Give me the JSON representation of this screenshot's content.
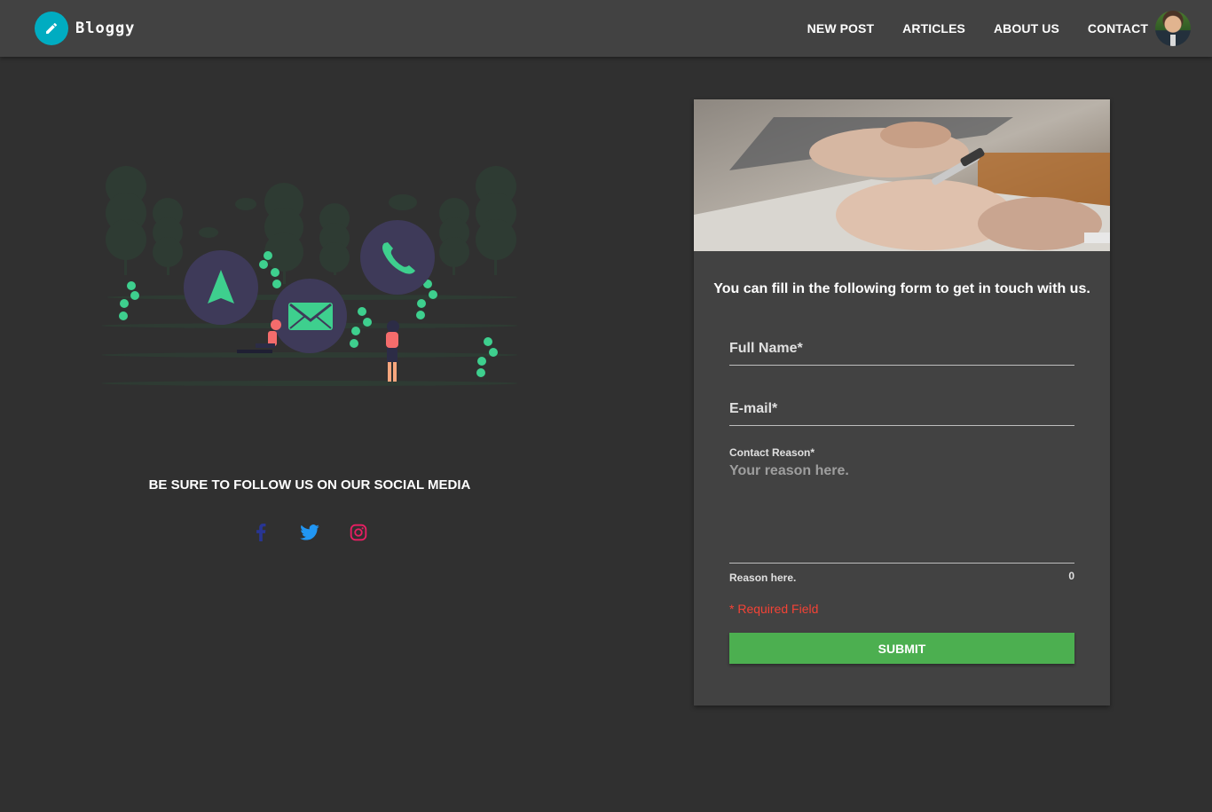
{
  "header": {
    "brand": "Bloggy",
    "nav": [
      "NEW POST",
      "ARTICLES",
      "ABOUT US",
      "CONTACT"
    ]
  },
  "social": {
    "heading": "BE SURE TO FOLLOW US ON OUR SOCIAL MEDIA",
    "links": [
      {
        "icon": "facebook-icon",
        "color": "#283593"
      },
      {
        "icon": "twitter-icon",
        "color": "#2196f3"
      },
      {
        "icon": "instagram-icon",
        "color": "#e91e63"
      }
    ]
  },
  "form": {
    "intro": "You can fill in the following form to get in touch with us.",
    "full_name_label": "Full Name*",
    "email_label": "E-mail*",
    "reason_label": "Contact Reason*",
    "reason_placeholder": "Your reason here.",
    "reason_hint": "Reason here.",
    "reason_counter": "0",
    "required_note": "* Required Field",
    "submit_label": "SUBMIT"
  },
  "colors": {
    "background": "#303030",
    "toolbar": "#424242",
    "accent": "#00acc1",
    "submit": "#4caf50",
    "required": "#f44336"
  }
}
